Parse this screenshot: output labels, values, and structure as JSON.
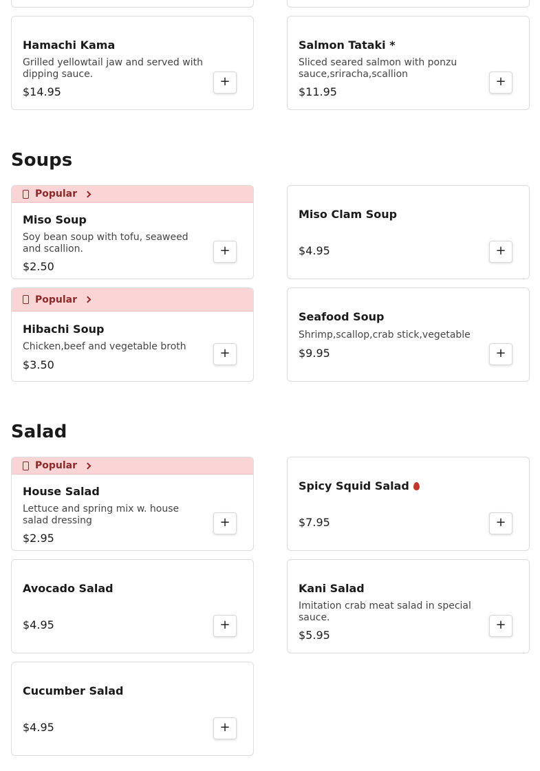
{
  "appetizers": {
    "items": [
      {
        "name": "Hamachi Kama",
        "description": "Grilled yellowtail jaw and served with dipping sauce.",
        "price": "$14.95"
      },
      {
        "name": "Salmon Tataki *",
        "description": "Sliced seared salmon with ponzu sauce,sriracha,scallion",
        "price": "$11.95"
      }
    ]
  },
  "soups": {
    "title": "Soups",
    "popular_label": "Popular",
    "items": [
      {
        "name": "Miso Soup",
        "description": "Soy bean soup with tofu, seaweed and scallion.",
        "price": "$2.50",
        "popular": true
      },
      {
        "name": "Miso Clam Soup",
        "description": "",
        "price": "$4.95",
        "popular": false
      },
      {
        "name": "Hibachi Soup",
        "description": "Chicken,beef and vegetable broth",
        "price": "$3.50",
        "popular": true
      },
      {
        "name": "Seafood Soup",
        "description": "Shrimp,scallop,crab stick,vegetable",
        "price": "$9.95",
        "popular": false
      }
    ]
  },
  "salad": {
    "title": "Salad",
    "popular_label": "Popular",
    "items": [
      {
        "name": "House Salad",
        "description": "Lettuce and spring mix w. house salad dressing",
        "price": "$2.95",
        "popular": true
      },
      {
        "name": "Spicy Squid Salad",
        "description": "",
        "price": "$7.95",
        "spicy": true,
        "spicy_icon": "chili-pepper-icon"
      },
      {
        "name": "Avocado Salad",
        "description": "",
        "price": "$4.95"
      },
      {
        "name": "Kani Salad",
        "description": "Imitation crab meat salad in special sauce.",
        "price": "$5.95"
      },
      {
        "name": "Cucumber Salad",
        "description": "",
        "price": "$4.95"
      }
    ]
  },
  "add_button_label": "+",
  "colors": {
    "popular_bg": "#fbd5d5",
    "popular_text": "#8b2a2a",
    "spicy": "#c0392b"
  }
}
